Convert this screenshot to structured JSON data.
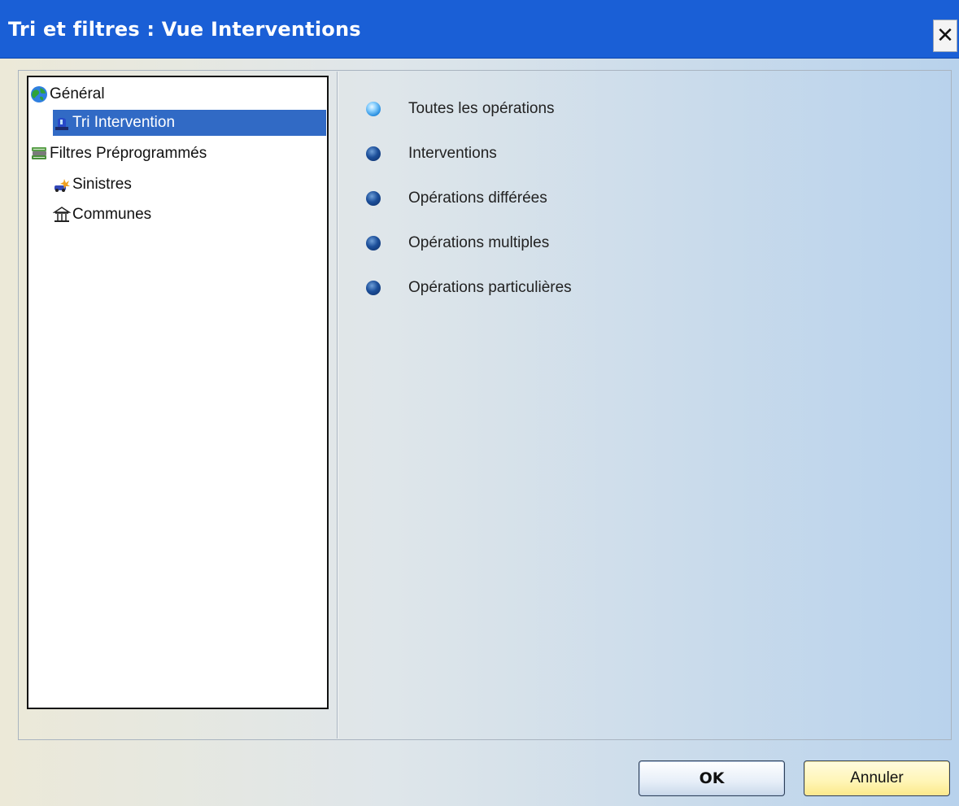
{
  "window": {
    "title": "Tri et filtres : Vue Interventions",
    "close_label": "✕"
  },
  "tree": {
    "items": [
      {
        "label": "Général",
        "icon": "globe-icon",
        "selected": false,
        "level": 0
      },
      {
        "label": "Tri Intervention",
        "icon": "beacon-icon",
        "selected": true,
        "level": 1
      },
      {
        "label": "Filtres Préprogrammés",
        "icon": "books-icon",
        "selected": false,
        "level": 0
      },
      {
        "label": "Sinistres",
        "icon": "incident-icon",
        "selected": false,
        "level": 1
      },
      {
        "label": "Communes",
        "icon": "town-hall-icon",
        "selected": false,
        "level": 1
      }
    ]
  },
  "options": {
    "items": [
      {
        "label": "Toutes les opérations",
        "selected": true
      },
      {
        "label": "Interventions",
        "selected": false
      },
      {
        "label": "Opérations différées",
        "selected": false
      },
      {
        "label": "Opérations multiples",
        "selected": false
      },
      {
        "label": "Opérations particulières",
        "selected": false
      }
    ]
  },
  "buttons": {
    "ok_label": "OK",
    "cancel_label": "Annuler"
  },
  "colors": {
    "titlebar": "#1a5fd6",
    "selection": "#316ac5",
    "radio_active": "#2a8fe0",
    "radio_inactive": "#1c4f9a"
  }
}
